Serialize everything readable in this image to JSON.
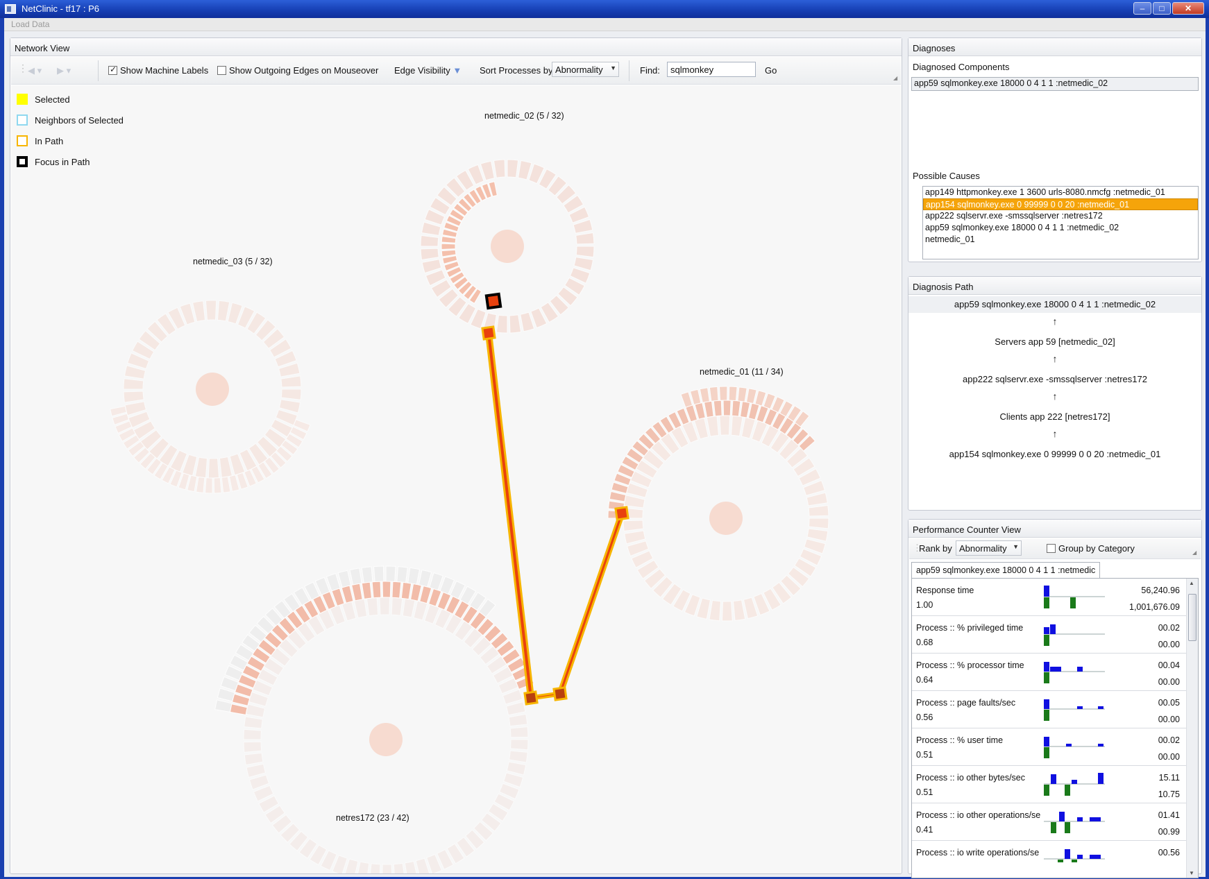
{
  "window": {
    "title": "NetClinic - tf17 : P6"
  },
  "menu": {
    "load_data": "Load Data"
  },
  "network_view": {
    "title": "Network View",
    "show_machine_labels": "Show Machine Labels",
    "show_outgoing_edges": "Show Outgoing Edges on Mouseover",
    "edge_visibility": "Edge Visibility",
    "sort_processes_by": "Sort Processes by",
    "sort_value": "Abnormality",
    "find_label": "Find:",
    "find_value": "sqlmonkey",
    "go": "Go",
    "legend": [
      {
        "label": "Selected",
        "color": "#ffff00"
      },
      {
        "label": "Neighbors of Selected",
        "color": "#8fd8ef"
      },
      {
        "label": "In Path",
        "color": "#f7b500"
      },
      {
        "label": "Focus in Path",
        "color": "#000000"
      }
    ],
    "machines": {
      "m02": "netmedic_02 (5 / 32)",
      "m03": "netmedic_03 (5 / 32)",
      "m01": "netmedic_01 (11 / 34)",
      "m172": "netres172 (23 / 42)"
    }
  },
  "diagnoses": {
    "title": "Diagnoses",
    "components_label": "Diagnosed Components",
    "components": [
      "app59 sqlmonkey.exe  18000 0 4 1 1 :netmedic_02"
    ],
    "causes_label": "Possible Causes",
    "causes": [
      "app149 httpmonkey.exe   1 3600 urls-8080.nmcfg :netmedic_01",
      "app154 sqlmonkey.exe  0 99999 0 0 20 :netmedic_01",
      "app222 sqlservr.exe  -smssqlserver :netres172",
      "app59 sqlmonkey.exe  18000 0 4 1 1 :netmedic_02",
      "netmedic_01"
    ]
  },
  "diagnosis_path": {
    "title": "Diagnosis Path",
    "nodes": [
      "app59 sqlmonkey.exe  18000 0 4 1 1 :netmedic_02",
      "Servers app 59 [netmedic_02]",
      "app222 sqlservr.exe  -smssqlserver :netres172",
      "Clients app 222 [netres172]",
      "app154 sqlmonkey.exe  0 99999 0 0 20 :netmedic_01"
    ],
    "arrow": "↑"
  },
  "perf": {
    "title": "Performance Counter View",
    "rank_by": "Rank by",
    "rank_value": "Abnormality",
    "group_by_category": "Group by Category",
    "tab": "app59 sqlmonkey.exe  18000 0 4 1 1 :netmedic",
    "counters": [
      {
        "name": "Response time",
        "score": "1.00",
        "v1": "56,240.96",
        "v2": "1,001,676.09"
      },
      {
        "name": "Process :: % privileged time",
        "score": "0.68",
        "v1": "00.02",
        "v2": "00.00"
      },
      {
        "name": "Process :: % processor time",
        "score": "0.64",
        "v1": "00.04",
        "v2": "00.00"
      },
      {
        "name": "Process :: page faults/sec",
        "score": "0.56",
        "v1": "00.05",
        "v2": "00.00"
      },
      {
        "name": "Process :: % user time",
        "score": "0.51",
        "v1": "00.02",
        "v2": "00.00"
      },
      {
        "name": "Process :: io other bytes/sec",
        "score": "0.51",
        "v1": "15.11",
        "v2": "10.75"
      },
      {
        "name": "Process :: io other operations/se",
        "score": "0.41",
        "v1": "01.41",
        "v2": "00.99"
      },
      {
        "name": "Process :: io write operations/se",
        "score": "",
        "v1": "00.56",
        "v2": ""
      }
    ]
  }
}
